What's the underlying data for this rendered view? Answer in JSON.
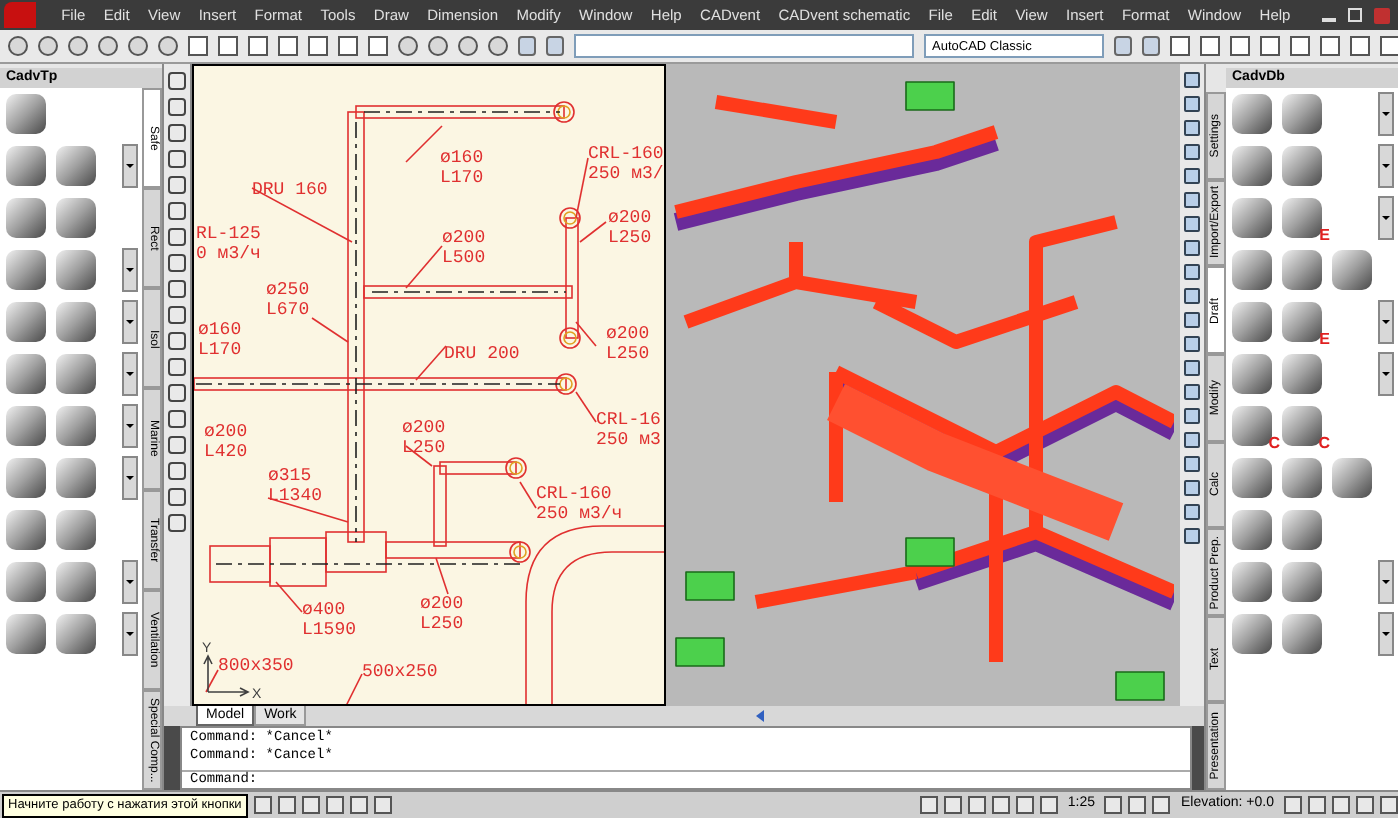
{
  "menu_bar": {
    "items": [
      "File",
      "Edit",
      "View",
      "Insert",
      "Format",
      "Tools",
      "Draw",
      "Dimension",
      "Modify",
      "Window",
      "Help",
      "CADvent",
      "CADvent schematic",
      "File",
      "Edit",
      "View",
      "Insert",
      "Format",
      "Window",
      "Help"
    ]
  },
  "toolbar": {
    "workspace_combo": {
      "value": "AutoCAD Classic"
    }
  },
  "left_palette": {
    "title": "CadvTp",
    "tabs": [
      {
        "label": "Safe",
        "selected": true
      },
      {
        "label": "Rect",
        "selected": false
      },
      {
        "label": "Isol",
        "selected": false
      },
      {
        "label": "Marine",
        "selected": false
      },
      {
        "label": "Transfer",
        "selected": false
      },
      {
        "label": "Ventilation",
        "selected": false
      },
      {
        "label": "Special Comp...",
        "selected": false
      }
    ]
  },
  "drawing": {
    "labels": [
      "ø160",
      "L170",
      "CRL-160",
      "250 м3/",
      "DRU 160",
      "RL-125",
      "0 м3/ч",
      "ø200",
      "L500",
      "ø200",
      "L250",
      "ø250",
      "L670",
      "ø160",
      "L170",
      "ø200",
      "DRU 200",
      "L250",
      "CRL-16",
      "250 м3",
      "ø200",
      "L420",
      "ø200",
      "L250",
      "ø315",
      "L1340",
      "CRL-160",
      "250 м3/ч",
      "ø400",
      "L1590",
      "ø200",
      "L250",
      "800x350",
      "500x250"
    ],
    "axis_labels": [
      "Y",
      "X"
    ]
  },
  "layout_tabs": [
    {
      "label": "Model",
      "selected": true
    },
    {
      "label": "Work",
      "selected": false
    }
  ],
  "right_palette": {
    "title": "CadvDb",
    "tabs": [
      {
        "label": "Settings",
        "selected": false
      },
      {
        "label": "Import/Export",
        "selected": false
      },
      {
        "label": "Draft",
        "selected": true
      },
      {
        "label": "Modify",
        "selected": false
      },
      {
        "label": "Calc",
        "selected": false
      },
      {
        "label": "Product Prep.",
        "selected": false
      },
      {
        "label": "Text",
        "selected": false
      },
      {
        "label": "Presentation",
        "selected": false
      }
    ],
    "badges": [
      "E",
      "E",
      "C",
      "C"
    ]
  },
  "command_line": {
    "history": [
      "Command: *Cancel*",
      "Command: *Cancel*"
    ],
    "prompt": "Command:"
  },
  "status_bar": {
    "tooltip": "Начните работу с нажатия этой кнопки",
    "scale": "1:25",
    "elevation": "Elevation: +0.0"
  }
}
